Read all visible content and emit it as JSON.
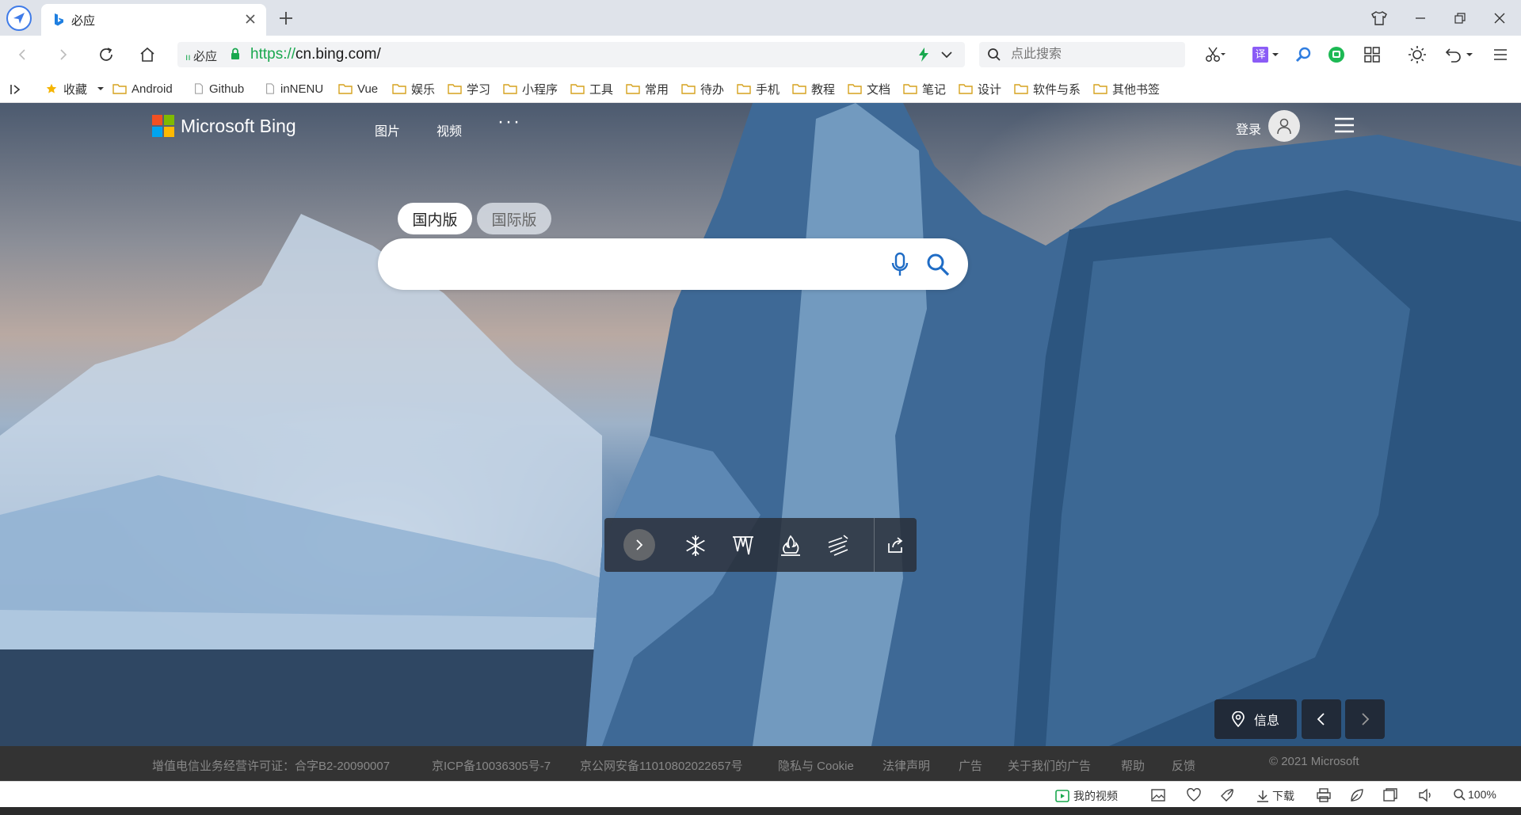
{
  "browser": {
    "tab": {
      "title": "必应"
    },
    "address": {
      "site_tag": "必应",
      "url_protocol": "https://",
      "url_host": "cn.bing.com/"
    },
    "search": {
      "placeholder": "点此搜索"
    },
    "translate_label": "译",
    "bookmarks": [
      {
        "label": "收藏",
        "type": "star"
      },
      {
        "label": "Android",
        "type": "folder"
      },
      {
        "label": "Github",
        "type": "page"
      },
      {
        "label": "inNENU",
        "type": "page"
      },
      {
        "label": "Vue",
        "type": "folder"
      },
      {
        "label": "娱乐",
        "type": "folder"
      },
      {
        "label": "学习",
        "type": "folder"
      },
      {
        "label": "小程序",
        "type": "folder"
      },
      {
        "label": "工具",
        "type": "folder"
      },
      {
        "label": "常用",
        "type": "folder"
      },
      {
        "label": "待办",
        "type": "folder"
      },
      {
        "label": "手机",
        "type": "folder"
      },
      {
        "label": "教程",
        "type": "folder"
      },
      {
        "label": "文档",
        "type": "folder"
      },
      {
        "label": "笔记",
        "type": "folder"
      },
      {
        "label": "设计",
        "type": "folder"
      },
      {
        "label": "软件与系",
        "type": "folder"
      },
      {
        "label": "其他书签",
        "type": "folder"
      }
    ]
  },
  "bing": {
    "logo_text": "Microsoft Bing",
    "nav": [
      "图片",
      "视频"
    ],
    "more": "···",
    "login": "登录",
    "scope_tabs": [
      "国内版",
      "国际版"
    ],
    "search_value": "",
    "info_label": "信息"
  },
  "footer": {
    "links": [
      "增值电信业务经营许可证：合字B2-20090007",
      "京ICP备10036305号-7",
      "京公网安备11010802022657号",
      "隐私与 Cookie",
      "法律声明",
      "广告",
      "关于我们的广告",
      "帮助",
      "反馈"
    ],
    "copyright": "© 2021 Microsoft"
  },
  "statusbar": {
    "my_video": "我的视频",
    "download": "下载",
    "zoom": "100%"
  },
  "colors": {
    "accent_green": "#1aa84f",
    "browser_blue": "#3f7be8",
    "footer_bg": "#333333"
  }
}
